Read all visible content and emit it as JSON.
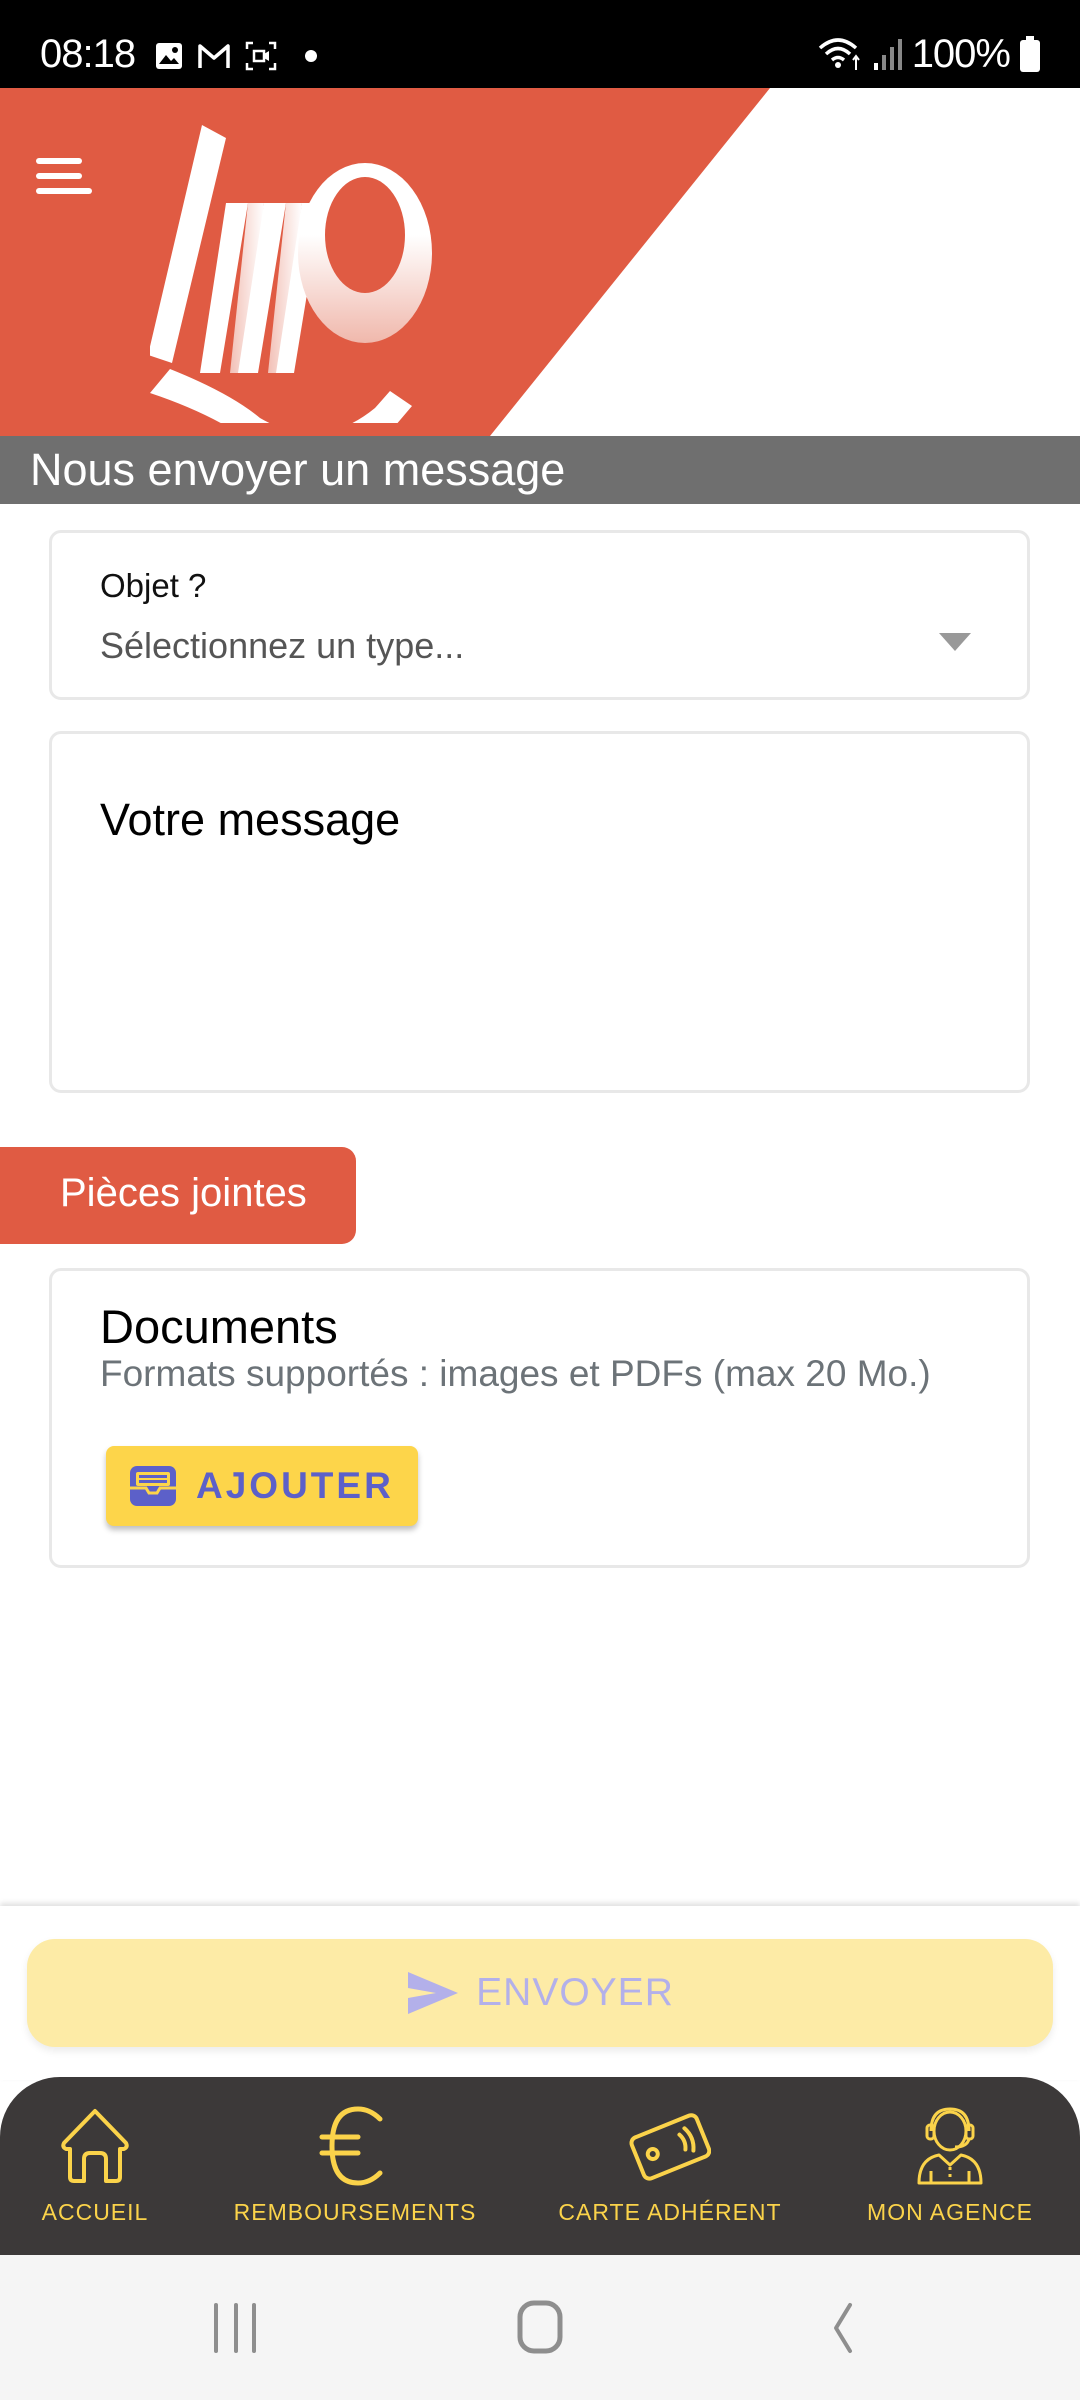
{
  "status_bar": {
    "time": "08:18",
    "battery": "100%",
    "left_icons": [
      "gallery-icon",
      "gmail-icon",
      "screen-record-icon",
      "dot-icon"
    ],
    "right_icons": [
      "wifi-icon",
      "signal-icon",
      "battery-icon"
    ]
  },
  "header": {
    "brand": "LMP",
    "colors": {
      "primary": "#e05b43",
      "title_bar": "#6f6f6f"
    }
  },
  "page": {
    "title": "Nous envoyer un message"
  },
  "form": {
    "object": {
      "label": "Objet ?",
      "value": "Sélectionnez un type..."
    },
    "message": {
      "placeholder": "Votre message",
      "value": ""
    }
  },
  "attachments": {
    "tab_label": "Pièces jointes",
    "documents_title": "Documents",
    "documents_subtitle": "Formats supportés : images et PDFs (max 20 Mo.)",
    "add_button": "AJOUTER"
  },
  "send_button": {
    "label": "ENVOYER",
    "disabled": true
  },
  "bottom_nav": {
    "items": [
      {
        "label": "ACCUEIL",
        "icon": "home-icon"
      },
      {
        "label": "REMBOURSEMENTS",
        "icon": "euro-icon"
      },
      {
        "label": "CARTE ADHÉRENT",
        "icon": "card-icon"
      },
      {
        "label": "MON AGENCE",
        "icon": "agent-icon"
      }
    ],
    "accent": "#fbd34a"
  },
  "system_nav": {
    "buttons": [
      "recent-apps",
      "home",
      "back"
    ]
  }
}
